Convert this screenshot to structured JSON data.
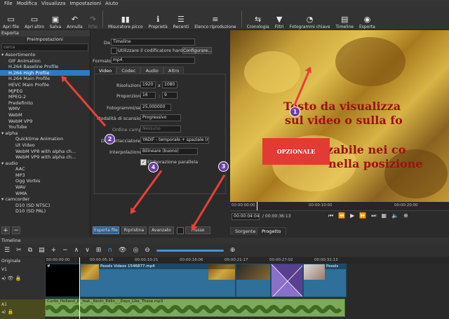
{
  "menu": [
    "File",
    "Modifica",
    "Visualizza",
    "Impostazioni",
    "Aiuto"
  ],
  "toolbar": [
    {
      "icon": "folder-open-icon",
      "label": "Apri file",
      "glyph": "📂"
    },
    {
      "icon": "folder-open-more-icon",
      "label": "Apri altro",
      "glyph": "📂"
    },
    {
      "icon": "save-icon",
      "label": "Salva",
      "glyph": "💾"
    },
    {
      "icon": "undo-icon",
      "label": "Annulla",
      "glyph": "↶"
    },
    {
      "icon": "redo-icon",
      "label": "Rifai",
      "glyph": "↷"
    },
    {
      "icon": "meter-icon",
      "label": "Misuratore picco",
      "glyph": "▮▮"
    },
    {
      "icon": "properties-icon",
      "label": "Proprietà",
      "glyph": "ℹ"
    },
    {
      "icon": "recent-icon",
      "label": "Recenti",
      "glyph": "☰"
    },
    {
      "icon": "playlist-icon",
      "label": "Elenco riproduzione",
      "glyph": "≡"
    },
    {
      "icon": "history-icon",
      "label": "Cronologia",
      "glyph": "⇆"
    },
    {
      "icon": "filter-icon",
      "label": "Filtri",
      "glyph": "⏷"
    },
    {
      "icon": "keyframes-icon",
      "label": "Fotogrammi chiave",
      "glyph": "⏱"
    },
    {
      "icon": "timeline-icon",
      "label": "Timeline",
      "glyph": "▤"
    },
    {
      "icon": "export-icon",
      "label": "Esporta",
      "glyph": "◉"
    }
  ],
  "export_panel": {
    "title": "Esporta",
    "presets_header": "Preimpostazioni",
    "search_placeholder": "cerca",
    "tree": [
      {
        "label": "▾ Assortimento",
        "level": 0
      },
      {
        "label": "GIF Animation",
        "level": 1
      },
      {
        "label": "H.264 Baseline Profile",
        "level": 1
      },
      {
        "label": "H.264 High Profile",
        "level": 1,
        "selected": true
      },
      {
        "label": "H.264 Main Profile",
        "level": 1
      },
      {
        "label": "HEVC Main Profile",
        "level": 1
      },
      {
        "label": "MJPEG",
        "level": 1
      },
      {
        "label": "MPEG-2",
        "level": 1
      },
      {
        "label": "Predefinito",
        "level": 1
      },
      {
        "label": "WMV",
        "level": 1
      },
      {
        "label": "WebM",
        "level": 1
      },
      {
        "label": "WebM VP9",
        "level": 1
      },
      {
        "label": "YouTube",
        "level": 1
      },
      {
        "label": "▾ alpha",
        "level": 0
      },
      {
        "label": "Quicktime Animation",
        "level": 2
      },
      {
        "label": "Ut Video",
        "level": 2
      },
      {
        "label": "WebM VP8 with alpha ch...",
        "level": 2
      },
      {
        "label": "WebM VP9 with alpha ch...",
        "level": 2
      },
      {
        "label": "▾ audio",
        "level": 0
      },
      {
        "label": "AAC",
        "level": 2
      },
      {
        "label": "MP3",
        "level": 2
      },
      {
        "label": "Ogg Vorbis",
        "level": 2
      },
      {
        "label": "WAV",
        "level": 2
      },
      {
        "label": "WMA",
        "level": 2
      },
      {
        "label": "▾ camcorder",
        "level": 0
      },
      {
        "label": "D10 (SD NTSC)",
        "level": 2
      },
      {
        "label": "D10 (SD PAL)",
        "level": 2
      }
    ],
    "add_label": "+",
    "remove_label": "−",
    "da_label": "Da",
    "da_value": "Timeline",
    "hw_label": "Utilizzare il codificatore hardware",
    "configure_label": "Configurare...",
    "format_label": "Formato",
    "format_value": "mp4",
    "tabs": [
      "Video",
      "Codec",
      "Audio",
      "Altro"
    ],
    "res_label": "Risoluzione",
    "res_w": "1920",
    "res_x": "x",
    "res_h": "1080",
    "aspect_label": "Proporzioni",
    "aspect_w": "16",
    "aspect_sep": ":",
    "aspect_h": "9",
    "fps_label": "Fotogrammi/sec",
    "fps_value": "25,000000",
    "scan_label": "Modalità di scansione",
    "scan_value": "Progressivo",
    "field_label": "Ordine campi",
    "field_value": "Nessuno",
    "deint_label": "Deinterlacciatore",
    "deint_value": "YADIF - temporale + spaziale (n",
    "interp_label": "Interpolazione",
    "interp_value": "Bilineare (buono)",
    "parallel_label": "Elaborazione parallela",
    "btn_export": "Esporta file",
    "btn_reset": "Ripristina",
    "btn_advanced": "Avanzato",
    "btn_stream": "Flusso"
  },
  "overlay": {
    "line1": "Testo da visualizza",
    "line2": "sul video o sulla fo",
    "line3": "p          zzabile nei co",
    "line4": "nella posizione",
    "callout": "OPZIONALE",
    "badges": [
      "1",
      "2",
      "3",
      "4"
    ]
  },
  "player": {
    "ruler": [
      "00:00:00:00",
      "00:00:10:00",
      "00:00:20:00"
    ],
    "current": "00:00:04:04",
    "total": "/ 00:00:36:13",
    "tab_source": "Sorgente",
    "tab_project": "Progetto"
  },
  "timeline": {
    "title": "Timeline",
    "track_header": "Originale",
    "ruler": [
      "00:00:00:00",
      "00:00:05:10",
      "00:00:10:21",
      "00:00:16:06",
      "00:00:21:17",
      "00:00:27:02",
      "00:00:32:13"
    ],
    "tracks": [
      {
        "name": "V1"
      },
      {
        "name": "A1"
      }
    ],
    "video_clips": [
      "#",
      "Pexels Videos 1546877.mp4",
      "",
      "",
      "Pexels"
    ],
    "audio_clip": "Curtis_Holland_Jr._feat._Kevin_Edlin_-_Days_Like_These.mp3"
  }
}
